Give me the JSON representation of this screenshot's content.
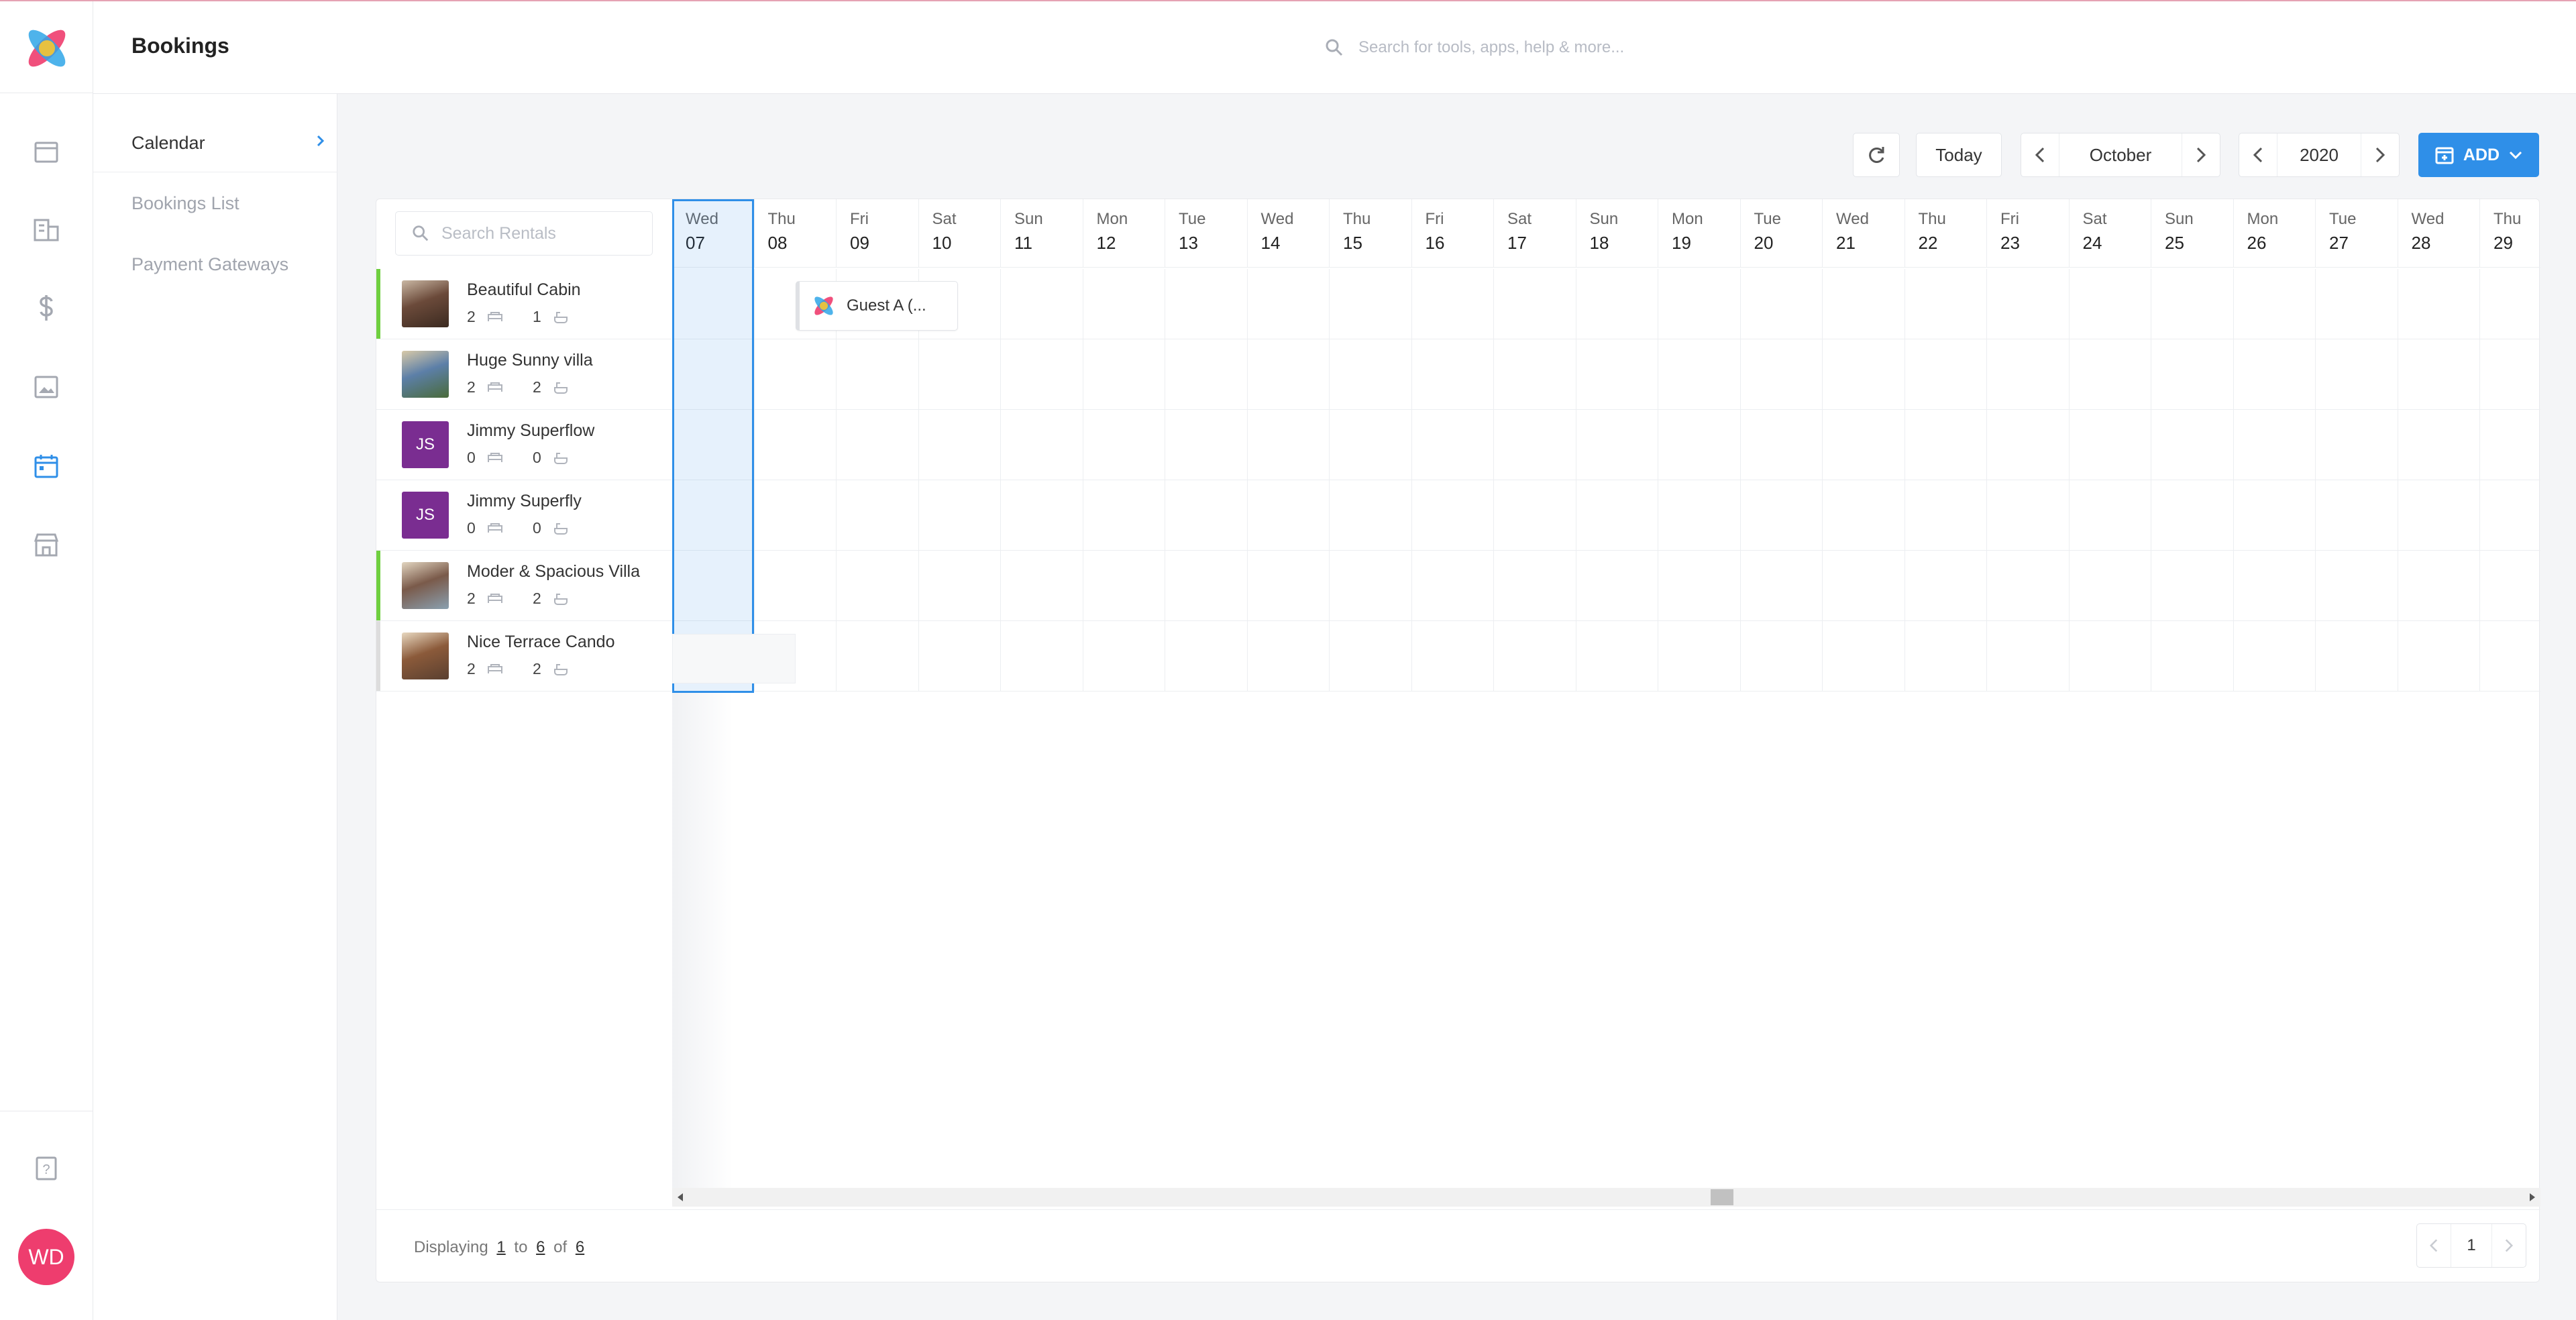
{
  "header": {
    "title": "Bookings",
    "search_placeholder": "Search for tools, apps, help & more..."
  },
  "user": {
    "initials": "WD"
  },
  "subnav": {
    "items": [
      {
        "label": "Calendar",
        "active": true
      },
      {
        "label": "Bookings List",
        "active": false
      },
      {
        "label": "Payment Gateways",
        "active": false
      }
    ]
  },
  "toolbar": {
    "today_label": "Today",
    "month": "October",
    "year": "2020",
    "add_label": "ADD"
  },
  "rentals_search_placeholder": "Search Rentals",
  "rentals": [
    {
      "name": "Beautiful Cabin",
      "beds": "2",
      "baths": "1",
      "thumb": "photo",
      "flag_color": "#6fcf3f"
    },
    {
      "name": "Huge Sunny villa",
      "beds": "2",
      "baths": "2",
      "thumb": "photo",
      "flag_color": "#ffffff"
    },
    {
      "name": "Jimmy Superflow",
      "beds": "0",
      "baths": "0",
      "thumb": "JS",
      "flag_color": "#ffffff"
    },
    {
      "name": "Jimmy Superfly",
      "beds": "0",
      "baths": "0",
      "thumb": "JS",
      "flag_color": "#ffffff"
    },
    {
      "name": "Moder & Spacious Villa",
      "beds": "2",
      "baths": "2",
      "thumb": "photo",
      "flag_color": "#6fcf3f"
    },
    {
      "name": "Nice Terrace Cando",
      "beds": "2",
      "baths": "2",
      "thumb": "photo",
      "flag_color": "#dddddd"
    }
  ],
  "days": [
    {
      "name": "Wed",
      "num": "07"
    },
    {
      "name": "Thu",
      "num": "08"
    },
    {
      "name": "Fri",
      "num": "09"
    },
    {
      "name": "Sat",
      "num": "10"
    },
    {
      "name": "Sun",
      "num": "11"
    },
    {
      "name": "Mon",
      "num": "12"
    },
    {
      "name": "Tue",
      "num": "13"
    },
    {
      "name": "Wed",
      "num": "14"
    },
    {
      "name": "Thu",
      "num": "15"
    },
    {
      "name": "Fri",
      "num": "16"
    },
    {
      "name": "Sat",
      "num": "17"
    },
    {
      "name": "Sun",
      "num": "18"
    },
    {
      "name": "Mon",
      "num": "19"
    },
    {
      "name": "Tue",
      "num": "20"
    },
    {
      "name": "Wed",
      "num": "21"
    },
    {
      "name": "Thu",
      "num": "22"
    },
    {
      "name": "Fri",
      "num": "23"
    },
    {
      "name": "Sat",
      "num": "24"
    },
    {
      "name": "Sun",
      "num": "25"
    },
    {
      "name": "Mon",
      "num": "26"
    },
    {
      "name": "Tue",
      "num": "27"
    },
    {
      "name": "Wed",
      "num": "28"
    },
    {
      "name": "Thu",
      "num": "29"
    }
  ],
  "booking": {
    "guest_label": "Guest A (..."
  },
  "footer": {
    "displaying": "Displaying",
    "from": "1",
    "to_word": "to",
    "to": "6",
    "of_word": "of",
    "total": "6",
    "page": "1"
  },
  "colors": {
    "accent": "#2f8fe8",
    "avatar": "#ee3d6e",
    "initials_thumb": "#7a2d91",
    "flag_green": "#6fcf3f"
  },
  "icons": {
    "rail": [
      "window-icon",
      "building-icon",
      "dollar-icon",
      "image-icon",
      "calendar-icon",
      "store-icon",
      "help-icon"
    ]
  }
}
